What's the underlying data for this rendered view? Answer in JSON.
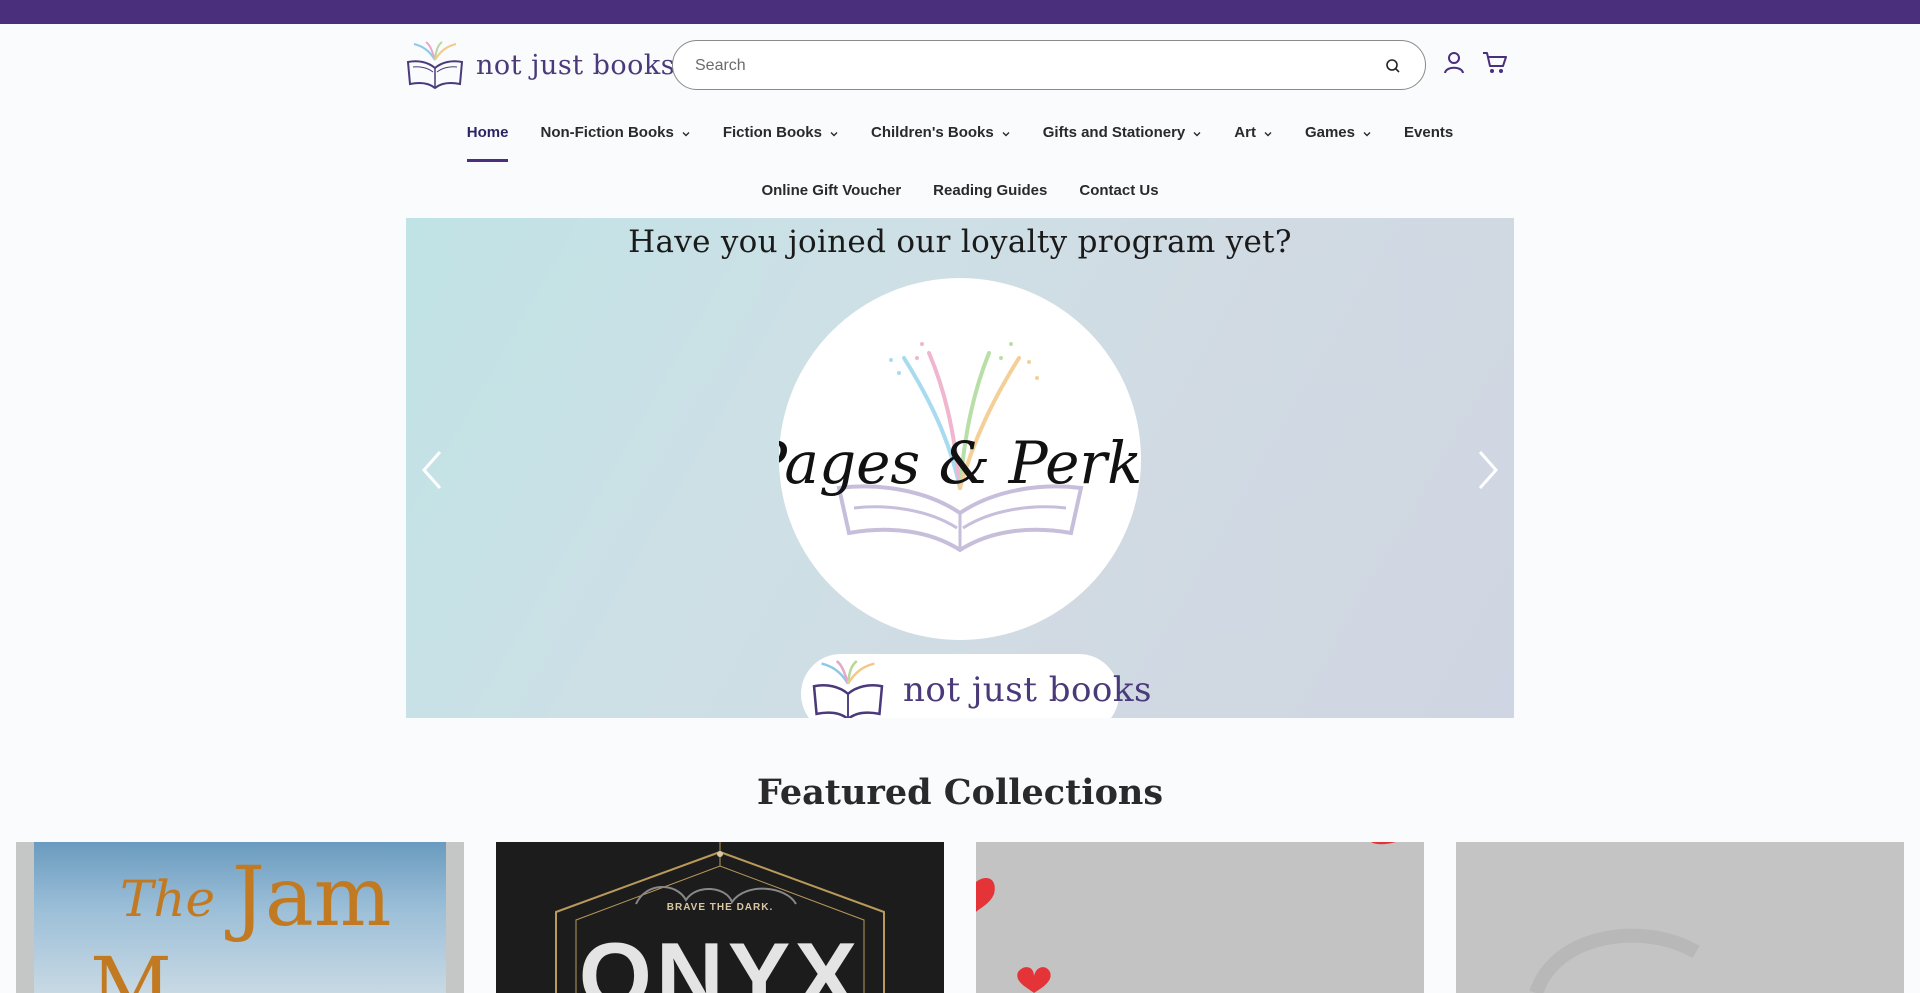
{
  "brand": {
    "name": "not just books"
  },
  "search": {
    "placeholder": "Search"
  },
  "nav": {
    "primary": [
      {
        "label": "Home",
        "has_dropdown": false,
        "active": true
      },
      {
        "label": "Non-Fiction Books",
        "has_dropdown": true
      },
      {
        "label": "Fiction Books",
        "has_dropdown": true
      },
      {
        "label": "Children's Books",
        "has_dropdown": true
      },
      {
        "label": "Gifts and Stationery",
        "has_dropdown": true
      },
      {
        "label": "Art",
        "has_dropdown": true
      },
      {
        "label": "Games",
        "has_dropdown": true
      },
      {
        "label": "Events",
        "has_dropdown": false
      }
    ],
    "secondary": [
      {
        "label": "Online Gift Voucher"
      },
      {
        "label": "Reading Guides"
      },
      {
        "label": "Contact Us"
      }
    ]
  },
  "banner": {
    "title": "Have you joined our loyalty program yet?",
    "program_name": "Pages & Perks",
    "footer_brand": "not just books"
  },
  "featured": {
    "title": "Featured Collections",
    "cards": [
      {
        "cover_text_1": "The",
        "cover_text_2": "Jam",
        "cover_text_3": "M"
      },
      {
        "cover_text_1": "BRAVE THE DARK.",
        "cover_text_2": "ONYX"
      },
      {},
      {}
    ]
  },
  "colors": {
    "top_bar": "#4a2f7d",
    "brand_purple": "#4a3a7a",
    "active_underline": "#4a2f7d"
  },
  "icons": {
    "search": "search-icon",
    "account": "user-icon",
    "cart": "cart-icon",
    "prev": "chevron-left-icon",
    "next": "chevron-right-icon",
    "dropdown": "chevron-down-icon"
  }
}
